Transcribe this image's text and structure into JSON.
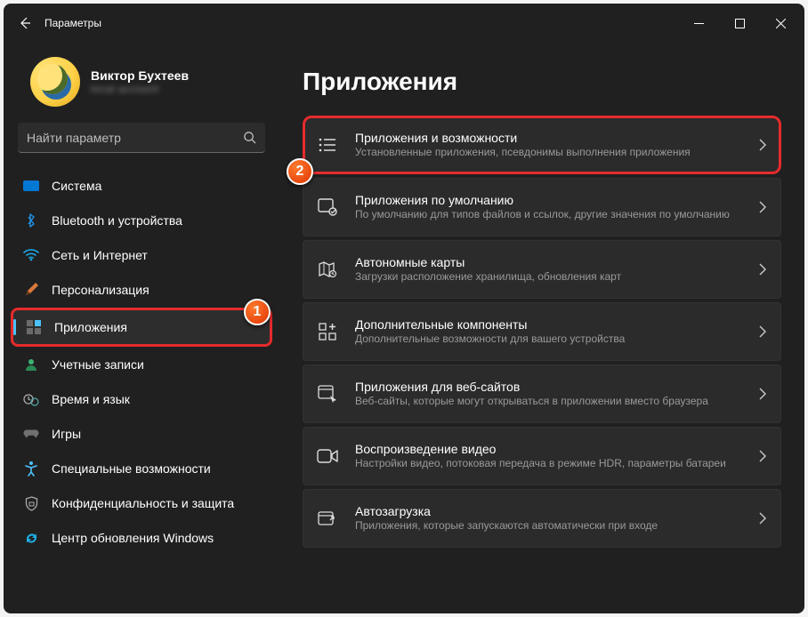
{
  "titlebar": {
    "app_title": "Параметры"
  },
  "profile": {
    "name": "Виктор Бухтеев",
    "sub": "local account"
  },
  "search": {
    "placeholder": "Найти параметр"
  },
  "nav": {
    "items": [
      {
        "label": "Система"
      },
      {
        "label": "Bluetooth и устройства"
      },
      {
        "label": "Сеть и Интернет"
      },
      {
        "label": "Персонализация"
      },
      {
        "label": "Приложения"
      },
      {
        "label": "Учетные записи"
      },
      {
        "label": "Время и язык"
      },
      {
        "label": "Игры"
      },
      {
        "label": "Специальные возможности"
      },
      {
        "label": "Конфиденциальность и защита"
      },
      {
        "label": "Центр обновления Windows"
      }
    ]
  },
  "page": {
    "title": "Приложения"
  },
  "cards": [
    {
      "title": "Приложения и возможности",
      "sub": "Установленные приложения, псевдонимы выполнения приложения"
    },
    {
      "title": "Приложения по умолчанию",
      "sub": "По умолчанию для типов файлов и ссылок, другие значения по умолчанию"
    },
    {
      "title": "Автономные карты",
      "sub": "Загрузки расположение хранилища, обновления карт"
    },
    {
      "title": "Дополнительные компоненты",
      "sub": "Дополнительные возможности для вашего устройства"
    },
    {
      "title": "Приложения для веб-сайтов",
      "sub": "Веб-сайты, которые могут открываться в приложении вместо браузера"
    },
    {
      "title": "Воспроизведение видео",
      "sub": "Настройки видео, потоковая передача в режиме HDR, параметры батареи"
    },
    {
      "title": "Автозагрузка",
      "sub": "Приложения, которые запускаются автоматически при входе"
    }
  ],
  "callouts": {
    "one": "1",
    "two": "2"
  }
}
